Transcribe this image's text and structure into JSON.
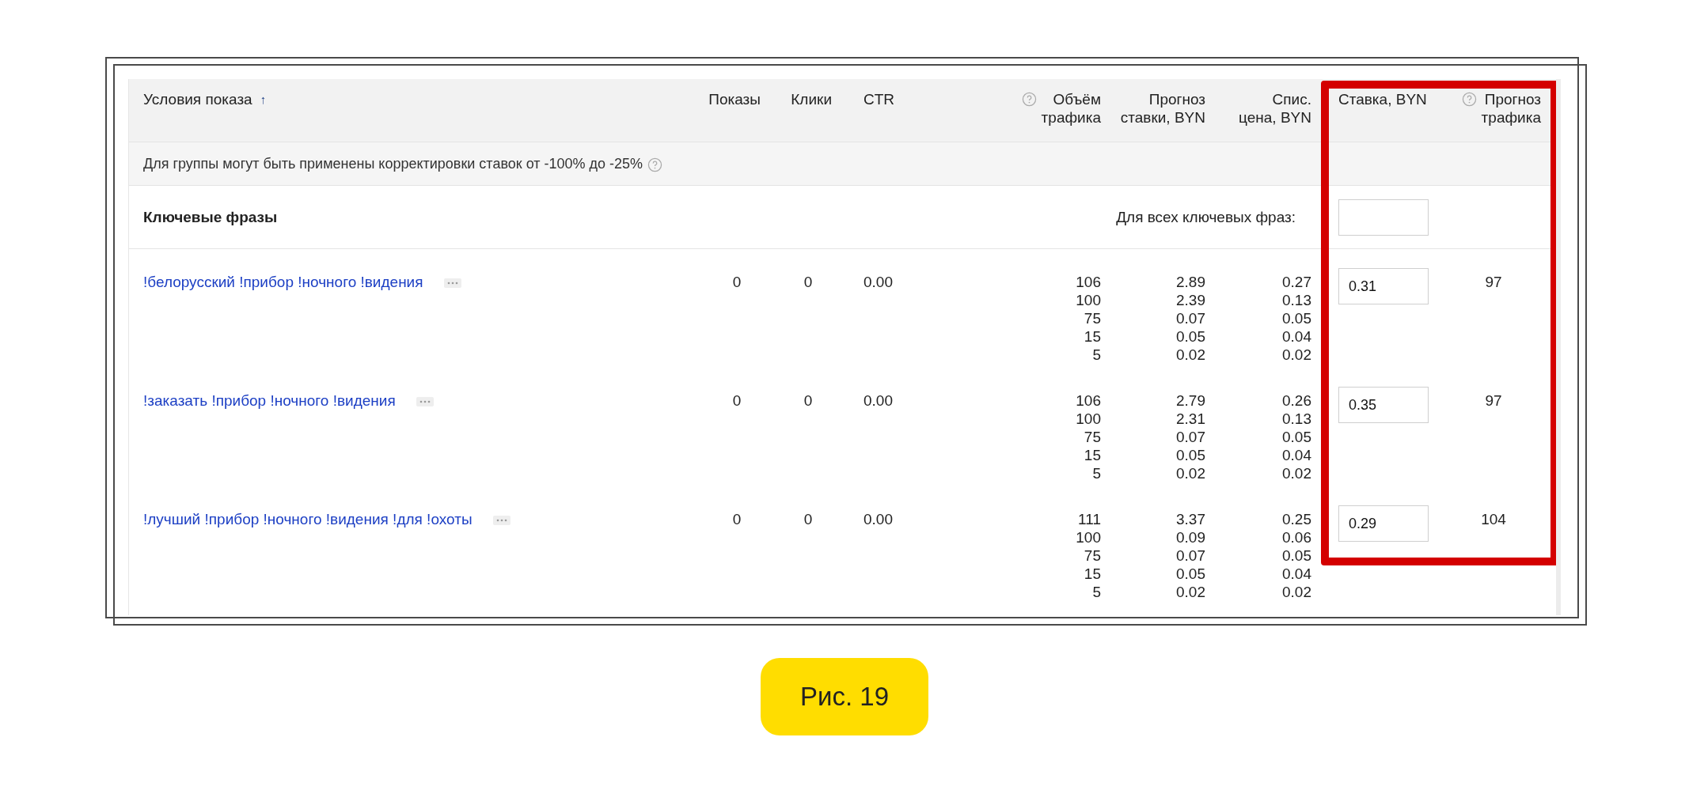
{
  "table": {
    "columns": [
      {
        "label": "Условия показа",
        "sort_mark": "↑",
        "help": false
      },
      {
        "label": "Показы",
        "help": false
      },
      {
        "label": "Клики",
        "help": false
      },
      {
        "label": "CTR",
        "help": false
      },
      {
        "label": "Объём\nтрафика",
        "help": true
      },
      {
        "label": "Прогноз\nставки, BYN",
        "help": false
      },
      {
        "label": "Спис.\nцена, BYN",
        "help": false
      },
      {
        "label": "Ставка, BYN",
        "help": false
      },
      {
        "label": "Прогноз\nтрафика",
        "help": true
      }
    ],
    "notice": {
      "text": "Для группы могут быть применены корректировки ставок от -100% до -25%",
      "help": true
    },
    "group": {
      "title": "Ключевые фразы",
      "all_label": "Для всех ключевых фраз:"
    },
    "rows": [
      {
        "phrase": "!белорусский !прибор !ночного !видения",
        "shows": "0",
        "clicks": "0",
        "ctr": "0.00",
        "traffic": [
          {
            "volume": "106",
            "bid": "2.89",
            "price": "0.27"
          },
          {
            "volume": "100",
            "bid": "2.39",
            "price": "0.13"
          },
          {
            "volume": "75",
            "bid": "0.07",
            "price": "0.05"
          },
          {
            "volume": "15",
            "bid": "0.05",
            "price": "0.04"
          },
          {
            "volume": "5",
            "bid": "0.02",
            "price": "0.02"
          }
        ],
        "bid": "0.31",
        "forecast": "97"
      },
      {
        "phrase": "!заказать !прибор !ночного !видения",
        "shows": "0",
        "clicks": "0",
        "ctr": "0.00",
        "traffic": [
          {
            "volume": "106",
            "bid": "2.79",
            "price": "0.26"
          },
          {
            "volume": "100",
            "bid": "2.31",
            "price": "0.13"
          },
          {
            "volume": "75",
            "bid": "0.07",
            "price": "0.05"
          },
          {
            "volume": "15",
            "bid": "0.05",
            "price": "0.04"
          },
          {
            "volume": "5",
            "bid": "0.02",
            "price": "0.02"
          }
        ],
        "bid": "0.35",
        "forecast": "97"
      },
      {
        "phrase": "!лучший !прибор !ночного !видения !для !охоты",
        "shows": "0",
        "clicks": "0",
        "ctr": "0.00",
        "traffic": [
          {
            "volume": "111",
            "bid": "3.37",
            "price": "0.25"
          },
          {
            "volume": "100",
            "bid": "0.09",
            "price": "0.06"
          },
          {
            "volume": "75",
            "bid": "0.07",
            "price": "0.05"
          },
          {
            "volume": "15",
            "bid": "0.05",
            "price": "0.04"
          },
          {
            "volume": "5",
            "bid": "0.02",
            "price": "0.02"
          }
        ],
        "bid": "0.29",
        "forecast": "104"
      }
    ]
  },
  "caption": "Рис. 19"
}
